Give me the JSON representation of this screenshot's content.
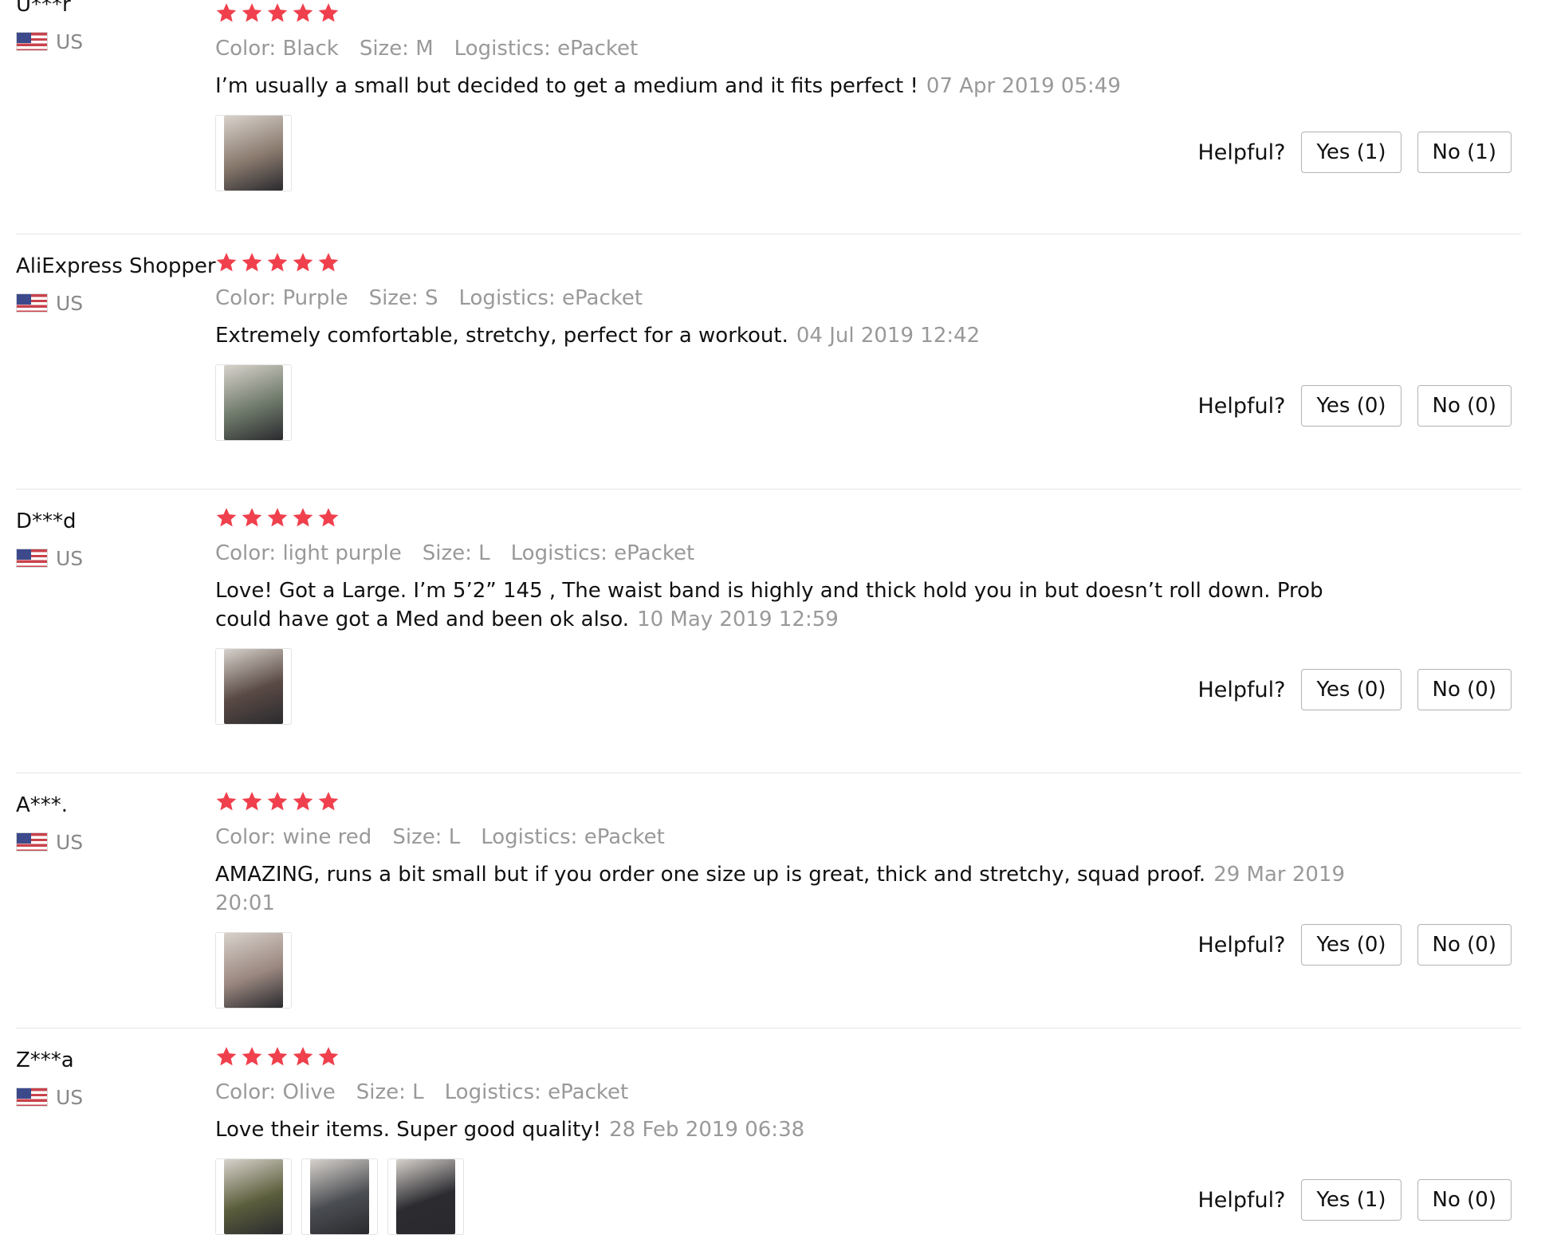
{
  "reviews": [
    {
      "user": "U***r",
      "country": "US",
      "rating": 5,
      "color_label": "Color:",
      "color": "Black",
      "size_label": "Size:",
      "size": "M",
      "logistics_label": "Logistics:",
      "logistics": "ePacket",
      "feedback": "I’m usually a small but decided to get a medium and it fits perfect !",
      "date": "07 Apr 2019 05:49",
      "photos": [
        {
          "tone": "#8a7a6e"
        }
      ],
      "helpful_label": "Helpful?",
      "yes_label": "Yes (1)",
      "no_label": "No (1)"
    },
    {
      "user": "AliExpress Shopper",
      "country": "US",
      "rating": 5,
      "color_label": "Color:",
      "color": "Purple",
      "size_label": "Size:",
      "size": "S",
      "logistics_label": "Logistics:",
      "logistics": "ePacket",
      "feedback": "Extremely comfortable, stretchy, perfect for a workout.",
      "date": "04 Jul 2019 12:42",
      "photos": [
        {
          "tone": "#6f7a6b"
        }
      ],
      "helpful_label": "Helpful?",
      "yes_label": "Yes (0)",
      "no_label": "No (0)"
    },
    {
      "user": "D***d",
      "country": "US",
      "rating": 5,
      "color_label": "Color:",
      "color": "light purple",
      "size_label": "Size:",
      "size": "L",
      "logistics_label": "Logistics:",
      "logistics": "ePacket",
      "feedback": "Love! Got a Large. I’m 5’2” 145 , The waist band is highly and thick hold you in but doesn’t roll down. Prob could have got a Med and been ok also.",
      "date": "10 May 2019 12:59",
      "photos": [
        {
          "tone": "#5a4a45"
        }
      ],
      "helpful_label": "Helpful?",
      "yes_label": "Yes (0)",
      "no_label": "No (0)"
    },
    {
      "user": "A***.",
      "country": "US",
      "rating": 5,
      "color_label": "Color:",
      "color": "wine red",
      "size_label": "Size:",
      "size": "L",
      "logistics_label": "Logistics:",
      "logistics": "ePacket",
      "feedback": "AMAZING, runs a bit small but if you order one size up is great, thick and stretchy, squad proof.",
      "date": "29 Mar 2019 20:01",
      "photos": [
        {
          "tone": "#9b8880"
        }
      ],
      "helpful_label": "Helpful?",
      "yes_label": "Yes (0)",
      "no_label": "No (0)"
    },
    {
      "user": "Z***a",
      "country": "US",
      "rating": 5,
      "color_label": "Color:",
      "color": "Olive",
      "size_label": "Size:",
      "size": "L",
      "logistics_label": "Logistics:",
      "logistics": "ePacket",
      "feedback": "Love their items. Super good quality!",
      "date": "28 Feb 2019 06:38",
      "photos": [
        {
          "tone": "#5b5e3c"
        },
        {
          "tone": "#4a4d52"
        },
        {
          "tone": "#2b2b30"
        }
      ],
      "helpful_label": "Helpful?",
      "yes_label": "Yes (1)",
      "no_label": "No (0)"
    }
  ],
  "colors": {
    "star": "#f0404d",
    "muted_text": "#999999",
    "divider": "#e6e6e6"
  }
}
